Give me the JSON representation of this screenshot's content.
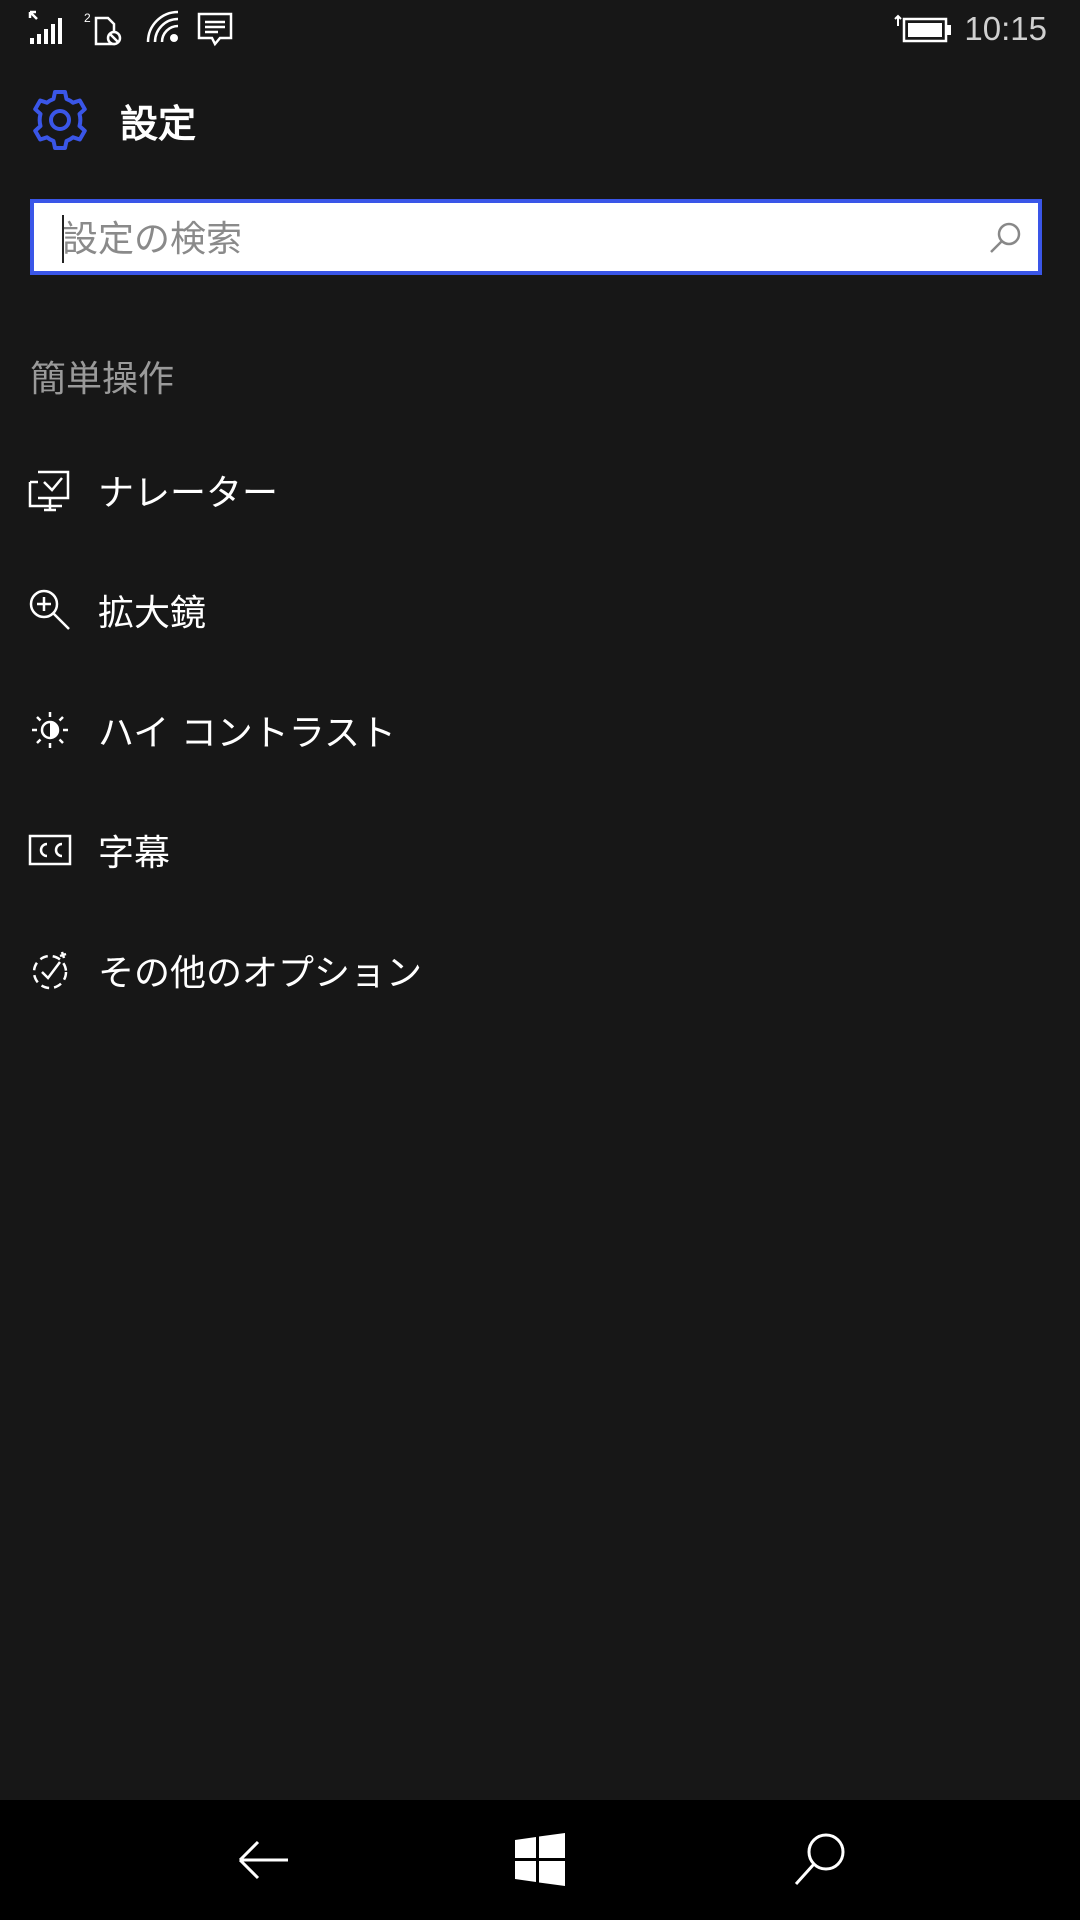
{
  "status_bar": {
    "time": "10:15",
    "sim_label": "2",
    "icons": [
      "signal-icon",
      "sim-icon",
      "wifi-icon",
      "message-icon",
      "battery-icon"
    ]
  },
  "header": {
    "title": "設定",
    "icon": "gear-icon"
  },
  "search": {
    "placeholder": "設定の検索",
    "value": ""
  },
  "section": {
    "title": "簡単操作",
    "items": [
      {
        "label": "ナレーター",
        "icon": "narrator-icon"
      },
      {
        "label": "拡大鏡",
        "icon": "magnifier-icon"
      },
      {
        "label": "ハイ コントラスト",
        "icon": "high-contrast-icon"
      },
      {
        "label": "字幕",
        "icon": "closed-captions-icon"
      },
      {
        "label": "その他のオプション",
        "icon": "more-options-icon"
      }
    ]
  },
  "nav_bar": {
    "buttons": [
      "back-icon",
      "windows-start-icon",
      "search-icon"
    ]
  },
  "colors": {
    "background": "#171717",
    "accent": "#3a56e8",
    "secondary_text": "#9a9a9a",
    "navbar": "#000000"
  }
}
